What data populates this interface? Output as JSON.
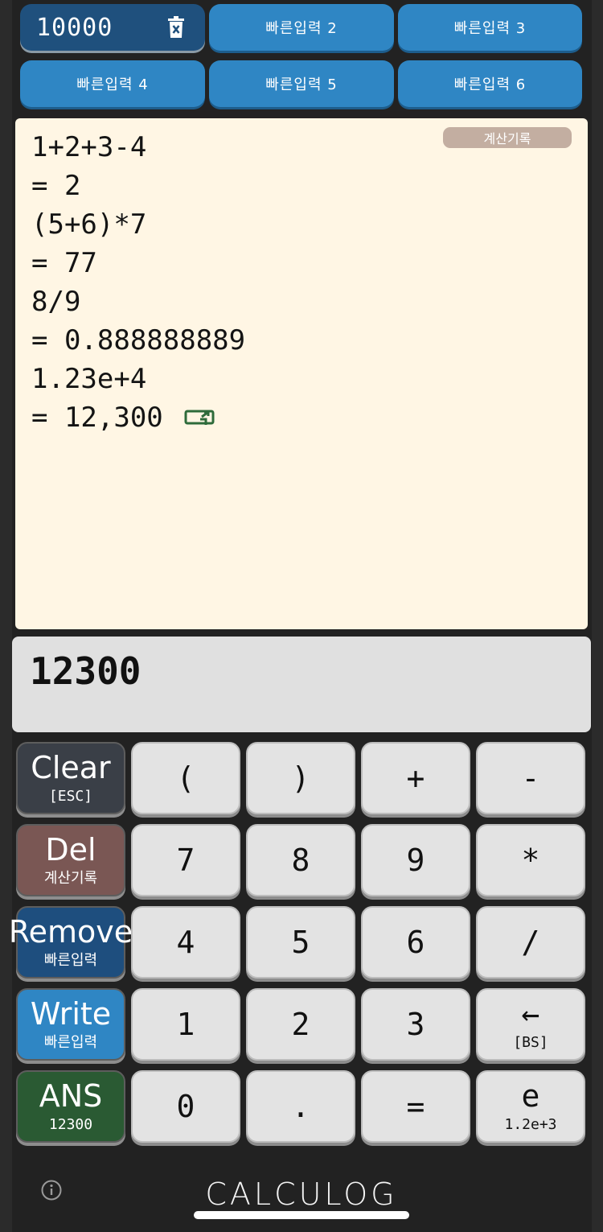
{
  "quick_inputs": [
    {
      "label": "10000"
    },
    {
      "label": "빠른입력 2"
    },
    {
      "label": "빠른입력 3"
    },
    {
      "label": "빠른입력 4"
    },
    {
      "label": "빠른입력 5"
    },
    {
      "label": "빠른입력 6"
    }
  ],
  "history": {
    "tag": "계산기록",
    "lines": [
      "1+2+3-4",
      "= 2",
      "(5+6)*7",
      "= 77",
      "8/9",
      "= 0.888888889",
      "1.23e+4",
      "= 12,300"
    ]
  },
  "display": {
    "value": "12300"
  },
  "keys": {
    "clear": {
      "main": "Clear",
      "sub": "[ESC]"
    },
    "lparen": {
      "main": "("
    },
    "rparen": {
      "main": ")"
    },
    "plus": {
      "main": "+"
    },
    "minus": {
      "main": "-"
    },
    "del": {
      "main": "Del",
      "sub": "계산기록"
    },
    "seven": {
      "main": "7"
    },
    "eight": {
      "main": "8"
    },
    "nine": {
      "main": "9"
    },
    "multiply": {
      "main": "*"
    },
    "remove": {
      "main": "Remove",
      "sub": "빠른입력"
    },
    "four": {
      "main": "4"
    },
    "five": {
      "main": "5"
    },
    "six": {
      "main": "6"
    },
    "divide": {
      "main": "/"
    },
    "write": {
      "main": "Write",
      "sub": "빠른입력"
    },
    "one": {
      "main": "1"
    },
    "two": {
      "main": "2"
    },
    "three": {
      "main": "3"
    },
    "backspace": {
      "main": "←",
      "sub": "[BS]"
    },
    "ans": {
      "main": "ANS",
      "sub": "12300"
    },
    "zero": {
      "main": "0"
    },
    "dot": {
      "main": "."
    },
    "equals": {
      "main": "="
    },
    "e": {
      "main": "e",
      "sub": "1.2e+3"
    }
  },
  "footer": {
    "brand": "CALCULOG"
  },
  "colors": {
    "quick_input": "#2f86c4",
    "quick_input_filled": "#1f507d",
    "history_bg": "#fff6e4",
    "clear_key": "#3a3f47",
    "del_key": "#7a5754",
    "remove_key": "#1e4e7e",
    "write_key": "#2f86c4",
    "ans_key": "#2a5a33",
    "copy_icon": "#2e6b3a"
  }
}
